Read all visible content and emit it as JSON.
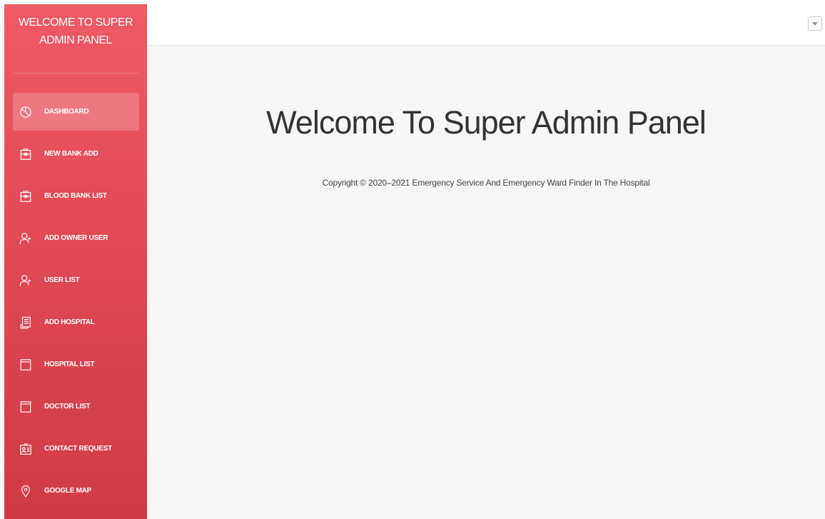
{
  "sidebar": {
    "brand_line1": "WELCOME TO SUPER",
    "brand_line2": "ADMIN PANEL",
    "items": [
      {
        "label": "DASHBOARD",
        "icon": "pie-chart-icon",
        "active": true
      },
      {
        "label": "NEW BANK ADD",
        "icon": "briefcase-icon",
        "active": false
      },
      {
        "label": "BLOOD BANK LIST",
        "icon": "briefcase-icon",
        "active": false
      },
      {
        "label": "ADD OWNER USER",
        "icon": "user-add-icon",
        "active": false
      },
      {
        "label": "USER LIST",
        "icon": "user-add-icon",
        "active": false
      },
      {
        "label": "ADD HOSPITAL",
        "icon": "document-icon",
        "active": false
      },
      {
        "label": "HOSPITAL LIST",
        "icon": "list-box-icon",
        "active": false
      },
      {
        "label": "DOCTOR LIST",
        "icon": "list-box-icon",
        "active": false
      },
      {
        "label": "CONTACT REQUEST",
        "icon": "contact-card-icon",
        "active": false
      },
      {
        "label": "GOOGLE MAP",
        "icon": "map-pin-icon",
        "active": false
      }
    ]
  },
  "topbar": {
    "dropdown_icon": "caret-down-icon"
  },
  "main": {
    "heading": "Welcome To Super Admin Panel",
    "copyright": "Copyright © 2020–2021 Emergency Service And Emergency Ward Finder In The Hospital"
  },
  "colors": {
    "sidebar_top": "#ee5a66",
    "sidebar_bottom": "#cf3a44",
    "content_bg": "#f6f6f6"
  }
}
